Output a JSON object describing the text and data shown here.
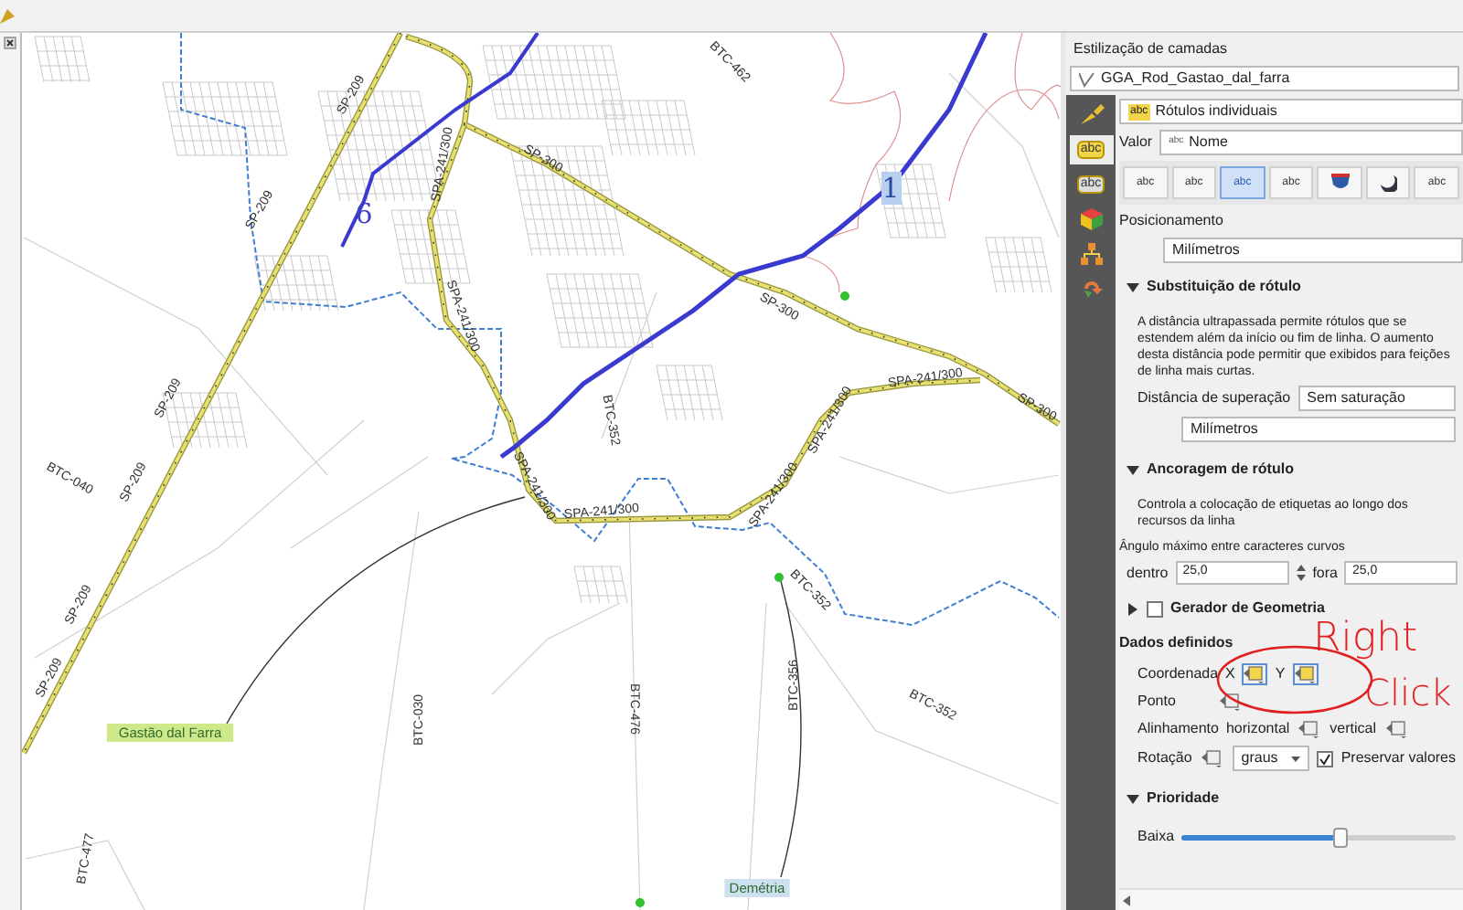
{
  "map": {
    "road_labels": [
      "SP-209",
      "SP-209",
      "SP-209",
      "SP-209",
      "SP-209",
      "SP-209",
      "BTC-040",
      "SP-300",
      "SP-300",
      "SP-300",
      "SPA-241/300",
      "SPA-241/300",
      "SPA-241/300",
      "SPA-241/300",
      "SPA-241/300",
      "SPA-241/300",
      "SPA-241/300",
      "BTC-462",
      "BTC-352",
      "BTC-352",
      "BTC-352",
      "BTC-030",
      "BTC-476",
      "BTC-356",
      "BTC-477"
    ],
    "place_labels": [
      "Gastão dal Farra",
      "Demétria"
    ],
    "route_numbers": [
      "6",
      "1"
    ]
  },
  "panel": {
    "title": "Estilização de camadas",
    "layer": "GGA_Rod_Gastao_dal_farra",
    "sidebar_items": [
      {
        "kind": "brush",
        "selected": false
      },
      {
        "kind": "text",
        "label": "abc",
        "selected": true
      },
      {
        "kind": "text",
        "label": "abc",
        "selected": false
      },
      {
        "kind": "cube",
        "selected": false
      },
      {
        "kind": "diagram",
        "selected": false
      },
      {
        "kind": "arrows",
        "selected": false
      }
    ],
    "renderer": {
      "tag": "abc",
      "label": "Rótulos individuais"
    },
    "value": {
      "label": "Valor",
      "tag": "abc",
      "field": "Nome"
    },
    "tabs": [
      {
        "kind": "text",
        "label": "abc",
        "selected": false
      },
      {
        "kind": "text",
        "label": "abc",
        "selected": false
      },
      {
        "kind": "text",
        "label": "abc",
        "selected": true
      },
      {
        "kind": "text",
        "label": "abc",
        "selected": false
      },
      {
        "kind": "shield",
        "selected": false
      },
      {
        "kind": "shadow",
        "selected": false
      },
      {
        "kind": "text",
        "label": "abc",
        "selected": false
      }
    ],
    "placement_title": "Posicionamento",
    "placement_unit": "Milímetros",
    "overrun": {
      "title": "Substituição de rótulo",
      "expanded": true,
      "text": "A distância ultrapassada permite rótulos que se estendem além da início ou fim de linha. O aumento desta distância pode permitir que exibidos para feições de linha mais curtas.",
      "distance_label": "Distância de superação",
      "distance_value": "Sem saturação",
      "unit": "Milímetros"
    },
    "anchor": {
      "title": "Ancoragem de rótulo",
      "expanded": true,
      "text": "Controla a colocação de etiquetas ao longo dos recursos da linha"
    },
    "angle": {
      "title": "Ângulo máximo entre caracteres curvos",
      "inside_label": "dentro",
      "inside_value": "25,0",
      "outside_label": "fora",
      "outside_value": "25,0"
    },
    "geometry_generator": {
      "title": "Gerador de Geometria",
      "expanded": false,
      "checked": false
    },
    "data_defined": {
      "title": "Dados definidos",
      "coordinate_label": "Coordenada",
      "x_label": "X",
      "x_active": true,
      "y_label": "Y",
      "y_active": true,
      "point_label": "Ponto",
      "align_label": "Alinhamento",
      "horizontal_label": "horizontal",
      "vertical_label": "vertical",
      "rotation_label": "Rotação",
      "rotation_unit": "graus",
      "preserve_label": "Preservar valores",
      "preserve_checked": true
    },
    "priority": {
      "title": "Prioridade",
      "expanded": true,
      "low_label": "Baixa",
      "level": 0.58
    }
  },
  "annotation": {
    "words": [
      "Right",
      "Click"
    ]
  }
}
